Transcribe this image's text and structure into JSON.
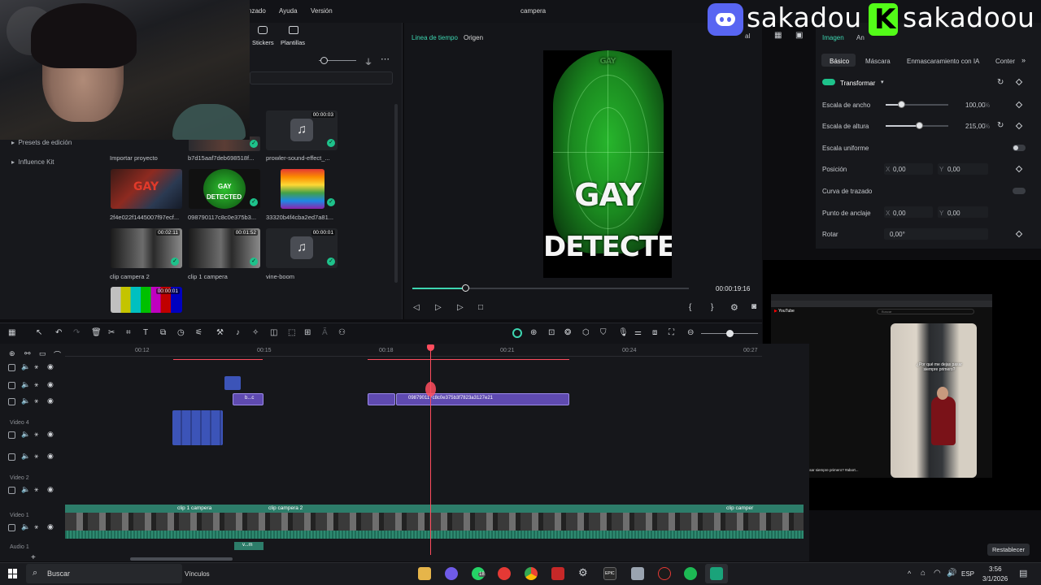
{
  "menu": {
    "items": [
      "nzado",
      "Ayuda",
      "Versión"
    ],
    "window_title": "campera"
  },
  "toolbar_top": {
    "stickers": "Stickers",
    "plantillas": "Plantillas"
  },
  "overlay": {
    "name1": "sakadou",
    "name2": "sakadoou"
  },
  "sidebar": {
    "items": [
      "Presets de edición",
      "Influence Kit"
    ]
  },
  "media": [
    {
      "label": "Importar proyecto",
      "duration": ""
    },
    {
      "label": "b7d15aaf7deb698518f...",
      "duration": ""
    },
    {
      "label": "prowler-sound-effect_...",
      "duration": "00:00:03"
    },
    {
      "label": "2f4e022f1445007f97ecf...",
      "duration": ""
    },
    {
      "label": "098790117c8c0e375b3...",
      "duration": "",
      "thumb_text_1": "GAY",
      "thumb_text_2": "DETECTED"
    },
    {
      "label": "33320b4f4cba2ed7a81...",
      "duration": ""
    },
    {
      "label": "clip campera 2",
      "duration": "00:02:11"
    },
    {
      "label": "clip 1 campera",
      "duration": "00:01:52"
    },
    {
      "label": "vine-boom",
      "duration": "00:00:01"
    },
    {
      "label": "",
      "duration": "00:00:01"
    }
  ],
  "player": {
    "tab_timeline": "Linea de tiempo",
    "tab_source": "Origen",
    "time": "00:00:19:16",
    "progress": 0.19,
    "video_top": "GAY",
    "video_text1": "GAY",
    "video_text2": "DETECTED",
    "quality": "al"
  },
  "inspector": {
    "tab_imagen": "Imagen",
    "tab_anim": "An",
    "subtabs": [
      "Básico",
      "Máscara",
      "Enmascaramiento con IA",
      "Conter"
    ],
    "transform_label": "Transformar",
    "rows": [
      {
        "label": "Escala de ancho",
        "value": "100,00",
        "unit": "%",
        "level": 0.25
      },
      {
        "label": "Escala de altura",
        "value": "215,00",
        "unit": "%",
        "level": 0.53
      },
      {
        "label": "Escala uniforme"
      },
      {
        "label": "Posición",
        "x": "0,00",
        "y": "0,00",
        "x_label": "X",
        "y_label": "Y"
      },
      {
        "label": "Curva de trazado"
      },
      {
        "label": "Punto de anclaje",
        "x": "0,00",
        "y": "0,00",
        "x_label": "X",
        "y_label": "Y"
      },
      {
        "label": "Rotar",
        "value": "0,00°"
      }
    ],
    "reset": "Restablecer"
  },
  "timeline": {
    "ruler": [
      "00:12",
      "00:15",
      "00:18",
      "00:21",
      "00:24",
      "00:27"
    ],
    "tracks": [
      "Video 4",
      "Video 2",
      "Video 1",
      "Audio 1"
    ],
    "clips": {
      "small": "b...c",
      "main": "098790117c8c0e375b3f7823a3127e21",
      "video1_a": "clip 1 campera",
      "video1_b": "clip campera 2",
      "video1_c": "clip camper",
      "audio": "v...m"
    }
  },
  "pip": {
    "caption": "¿Por qué me dejas pasar siempre primero?",
    "desc": "¿Por qué la deja pasar siempre primero? #abort...",
    "search": "Buscar",
    "yt": "YouTube"
  },
  "taskbar": {
    "search": "Buscar",
    "links": "Vínculos",
    "lang": "ESP",
    "time": "3:56",
    "date": "3/1/2026",
    "badge": "18",
    "epic": "EPIC"
  }
}
